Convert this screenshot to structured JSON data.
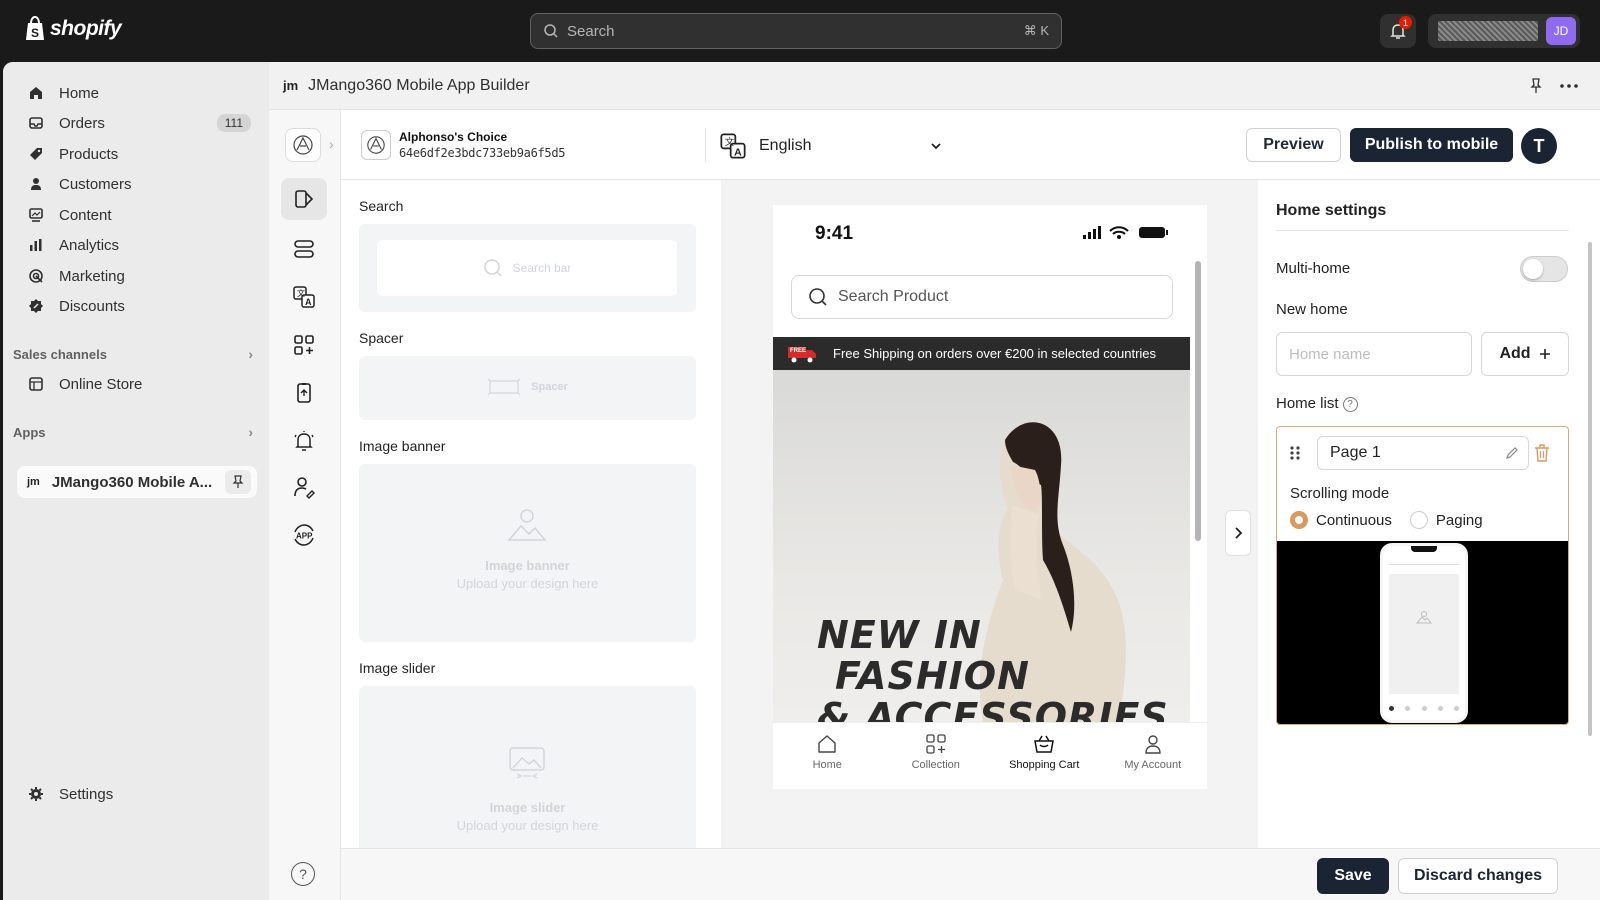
{
  "topbar": {
    "logo_text": "shopify",
    "search_placeholder": "Search",
    "search_shortcut": "⌘ K",
    "notification_count": "1",
    "user_initials": "JD"
  },
  "sidebar": {
    "items": [
      {
        "label": "Home",
        "icon": "home-icon"
      },
      {
        "label": "Orders",
        "icon": "orders-icon",
        "badge": "111"
      },
      {
        "label": "Products",
        "icon": "tag-icon"
      },
      {
        "label": "Customers",
        "icon": "person-icon"
      },
      {
        "label": "Content",
        "icon": "content-icon"
      },
      {
        "label": "Analytics",
        "icon": "bar-chart-icon"
      },
      {
        "label": "Marketing",
        "icon": "target-icon"
      },
      {
        "label": "Discounts",
        "icon": "discount-icon"
      }
    ],
    "sales_channels_title": "Sales channels",
    "online_store": "Online Store",
    "apps_title": "Apps",
    "app_item": "JMango360 Mobile A...",
    "settings": "Settings"
  },
  "app_header": {
    "logo_text": "jm",
    "title": "JMango360 Mobile App Builder"
  },
  "brandbar": {
    "store_name": "Alphonso's Choice",
    "store_id": "64e6df2e3bdc733eb9a6f5d5",
    "language": "English",
    "preview": "Preview",
    "publish": "Publish to mobile",
    "user_initial": "T"
  },
  "components": {
    "search_title": "Search",
    "search_bar": "Search bar",
    "spacer_title": "Spacer",
    "spacer": "Spacer",
    "image_banner_title": "Image banner",
    "image_banner": "Image banner",
    "image_banner_sub": "Upload your design here",
    "image_slider_title": "Image slider",
    "image_slider": "Image slider",
    "image_slider_sub": "Upload your design here"
  },
  "phone": {
    "time": "9:41",
    "search_placeholder": "Search Product",
    "free_badge": "FREE",
    "shipping_banner": "Free Shipping on orders over €200 in selected countries",
    "hero_line1": "NEW IN",
    "hero_line2": "FASHION",
    "hero_line3": "& ACCESSORIES",
    "tabs": [
      {
        "label": "Home",
        "icon": "home-outline-icon"
      },
      {
        "label": "Collection",
        "icon": "grid-plus-icon"
      },
      {
        "label": "Shopping Cart",
        "icon": "basket-icon"
      },
      {
        "label": "My Account",
        "icon": "user-outline-icon"
      }
    ]
  },
  "settings": {
    "title": "Home settings",
    "multi_home": "Multi-home",
    "multi_home_enabled": false,
    "new_home": "New home",
    "home_name_placeholder": "Home name",
    "add": "Add",
    "home_list": "Home list",
    "page_name": "Page 1",
    "scrolling_mode": "Scrolling mode",
    "continuous": "Continuous",
    "paging": "Paging",
    "selected_mode": "Continuous"
  },
  "footer": {
    "save": "Save",
    "discard": "Discard changes"
  },
  "colors": {
    "topbar_bg": "#1a1a1a",
    "primary_button": "#1b2433",
    "accent_orange": "#d99a5e",
    "avatar_purple": "#8f6bf2"
  }
}
